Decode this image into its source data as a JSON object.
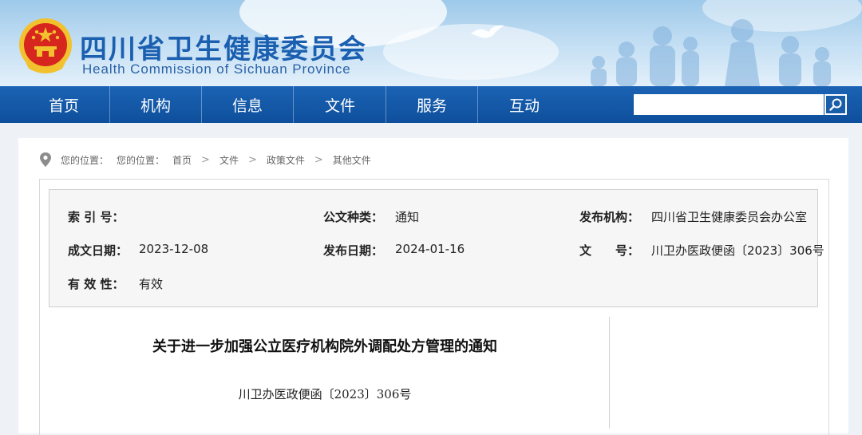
{
  "header": {
    "title_cn": "四川省卫生健康委员会",
    "title_en": "Health Commission of Sichuan Province"
  },
  "nav": {
    "items": [
      {
        "label": "首页"
      },
      {
        "label": "机构"
      },
      {
        "label": "信息"
      },
      {
        "label": "文件"
      },
      {
        "label": "服务"
      },
      {
        "label": "互动"
      }
    ],
    "search": {
      "value": "",
      "icon": "search-icon"
    }
  },
  "breadcrumb": {
    "prefix1": "您的位置：",
    "prefix2": "您的位置：",
    "items": [
      "首页",
      "文件",
      "政策文件",
      "其他文件"
    ],
    "separator": ">"
  },
  "meta": {
    "index_label": "索 引 号：",
    "index_value": "",
    "doc_type_label": "公文种类：",
    "doc_type_value": "通知",
    "issuer_label": "发布机构：",
    "issuer_value": "四川省卫生健康委员会办公室",
    "created_label": "成文日期：",
    "created_value": "2023-12-08",
    "published_label": "发布日期：",
    "published_value": "2024-01-16",
    "doc_no_label": "文　　号：",
    "doc_no_value": "川卫办医政便函〔2023〕306号",
    "validity_label": "有 效 性：",
    "validity_value": "有效"
  },
  "article": {
    "title": "关于进一步加强公立医疗机构院外调配处方管理的通知",
    "doc_number": "川卫办医政便函〔2023〕306号"
  },
  "colors": {
    "nav_blue": "#1b63b4",
    "title_blue": "#1b5fb0",
    "emblem_red": "#d7261e",
    "emblem_gold": "#f2c12e"
  }
}
